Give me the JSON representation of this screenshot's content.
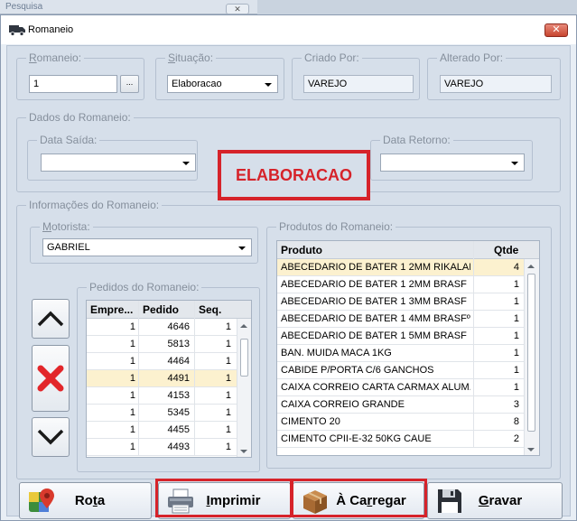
{
  "background_window": {
    "title": "Pesquisa",
    "close_label": "✕"
  },
  "window": {
    "title": "Romaneio",
    "close_label": "✕"
  },
  "fields": {
    "romaneio": {
      "label_u": "R",
      "label_rest": "omaneio:",
      "value": "1",
      "lookup_label": "..."
    },
    "situacao": {
      "label_u": "S",
      "label_rest": "ituação:",
      "value": "Elaboracao"
    },
    "criado_por": {
      "label": "Criado Por:",
      "value": "VAREJO"
    },
    "alterado_por": {
      "label": "Alterado Por:",
      "value": "VAREJO"
    }
  },
  "dados": {
    "label": "Dados do Romaneio:",
    "data_saida": {
      "label": "Data Saída:",
      "value": ""
    },
    "status_text": "ELABORACAO",
    "data_retorno": {
      "label": "Data Retorno:",
      "value": ""
    }
  },
  "info": {
    "label": "Informações do Romaneio:",
    "motorista": {
      "label_u": "M",
      "label_rest": "otorista:",
      "value": "GABRIEL"
    }
  },
  "pedidos": {
    "label": "Pedidos do Romaneio:",
    "columns": [
      "Empre...",
      "Pedido",
      "Seq."
    ],
    "rows": [
      [
        "1",
        "4646",
        "1"
      ],
      [
        "1",
        "5813",
        "1"
      ],
      [
        "1",
        "4464",
        "1"
      ],
      [
        "1",
        "4491",
        "1"
      ],
      [
        "1",
        "4153",
        "1"
      ],
      [
        "1",
        "5345",
        "1"
      ],
      [
        "1",
        "4455",
        "1"
      ],
      [
        "1",
        "4493",
        "1"
      ]
    ],
    "selected_row": 3
  },
  "produtos": {
    "label": "Produtos do Romaneio:",
    "columns": [
      "Produto",
      "Qtde"
    ],
    "rows": [
      [
        "ABECEDARIO DE BATER 1 2MM RIKALAR",
        "4"
      ],
      [
        "ABECEDARIO DE BATER 1 2MM BRASF",
        "1"
      ],
      [
        "ABECEDARIO DE BATER 1 3MM BRASF",
        "1"
      ],
      [
        "ABECEDARIO DE BATER 1 4MM BRASFº",
        "1"
      ],
      [
        "ABECEDARIO DE BATER 1 5MM BRASF",
        "1"
      ],
      [
        "BAN. MUIDA MACA 1KG",
        "1"
      ],
      [
        "CABIDE P/PORTA C/6 GANCHOS",
        "1"
      ],
      [
        "CAIXA CORREIO CARTA CARMAX ALUM....",
        "1"
      ],
      [
        "CAIXA CORREIO GRANDE",
        "3"
      ],
      [
        "CIMENTO 20",
        "8"
      ],
      [
        "CIMENTO CPII-E-32 50KG CAUE",
        "2"
      ]
    ],
    "selected_row": 0
  },
  "buttons": {
    "rota": {
      "u": "",
      "pre": "Ro",
      "und": "t",
      "post": "a"
    },
    "imprimir": {
      "pre": "",
      "und": "I",
      "post": "mprimir"
    },
    "carregar": {
      "pre": "À Ca",
      "und": "r",
      "post": "regar"
    },
    "gravar": {
      "pre": "",
      "und": "G",
      "post": "ravar"
    }
  },
  "colors": {
    "highlight_red": "#d6232a",
    "selected_row": "#fcf1cf",
    "window_bg": "#d6dfea"
  }
}
